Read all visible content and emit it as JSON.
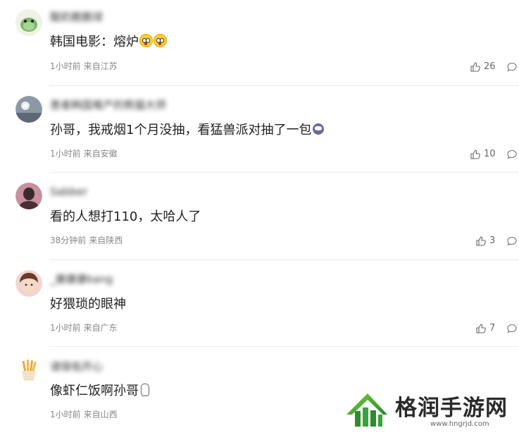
{
  "comments": [
    {
      "username": "酸奶脆脆球",
      "content": "韩国电影：熔炉",
      "time": "1小时前",
      "location": "来自江苏",
      "likes": "26",
      "emoji": "astonished-face"
    },
    {
      "username": "患者韩国难产的熊猫大师",
      "content": "孙哥，我戒烟1个月没抽，看猛兽派对抽了一包",
      "time": "1小时前",
      "location": "来自安徽",
      "likes": "10",
      "emoji": "smoking-face"
    },
    {
      "username": "Sabber",
      "content": "看的人想打110，太哈人了",
      "time": "38分钟前",
      "location": "来自陕西",
      "likes": "3"
    },
    {
      "username": "_康康康kang",
      "content": "好猥琐的眼神",
      "time": "1小时前",
      "location": "来自广东",
      "likes": "7"
    },
    {
      "username": "请保佑开心",
      "content": "像虾仁饭啊孙哥",
      "time": "1小时前",
      "location": "来自山西",
      "likes": "",
      "emoji": "hand"
    }
  ],
  "watermark": {
    "text": "格润手游网",
    "url": "www.hngrjd.com"
  },
  "colors": {
    "text": "#222222",
    "meta": "#888888",
    "divider": "#ececec",
    "watermark_green": "#2e8b2e"
  }
}
